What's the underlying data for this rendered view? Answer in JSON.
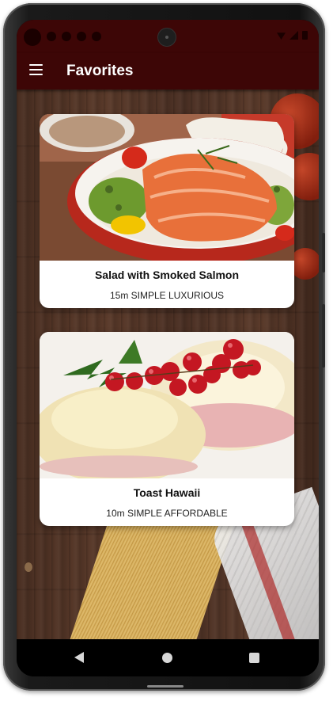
{
  "app_bar": {
    "title": "Favorites",
    "menu_icon": "hamburger-menu-icon",
    "background": "#3d0606"
  },
  "favorites": [
    {
      "title": "Salad with Smoked Salmon",
      "meta": "15m SIMPLE LUXURIOUS"
    },
    {
      "title": "Toast Hawaii",
      "meta": "10m SIMPLE AFFORDABLE"
    }
  ],
  "nav_bar": {
    "back_icon": "back-triangle-icon",
    "home_icon": "home-circle-icon",
    "recents_icon": "recents-square-icon"
  }
}
